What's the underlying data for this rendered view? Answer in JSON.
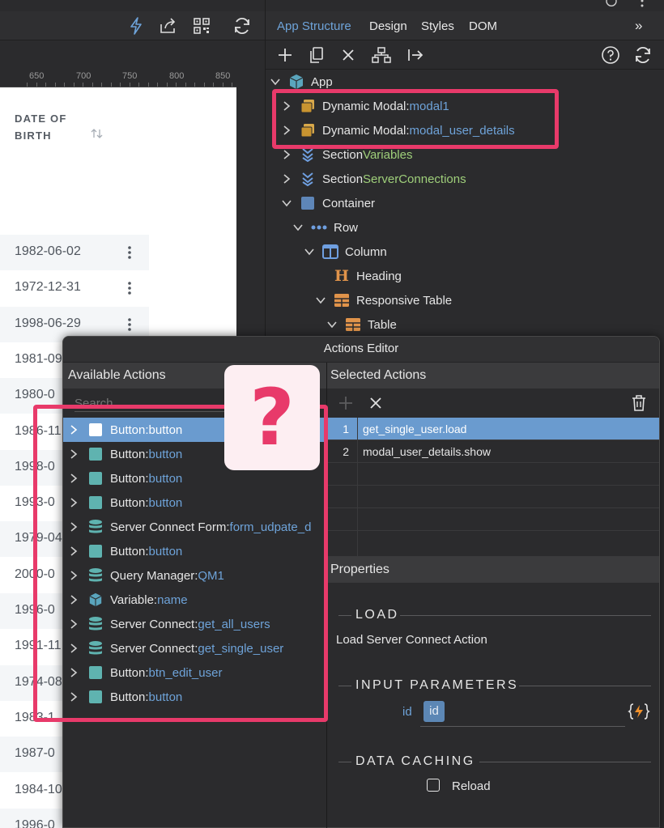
{
  "ruler": {
    "ticks": [
      "650",
      "700",
      "750",
      "800",
      "850"
    ]
  },
  "table": {
    "column_header": "DATE OF BIRTH",
    "rows": [
      "1982-06-02",
      "1972-12-31",
      "1998-06-29",
      "1981-09",
      "1980-0",
      "1986-11",
      "1998-0",
      "1993-0",
      "1979-04",
      "2000-0",
      "1996-0",
      "1991-11",
      "1974-08",
      "1983-1",
      "1987-0",
      "1984-10",
      "1996-0"
    ]
  },
  "panel": {
    "tabs": [
      "App Structure",
      "Design",
      "Styles",
      "DOM"
    ],
    "active_tab": "App Structure",
    "more": "»"
  },
  "tree": {
    "items": [
      {
        "label": "App",
        "value": ""
      },
      {
        "label": "Dynamic Modal: ",
        "value": "modal1"
      },
      {
        "label": "Dynamic Modal: ",
        "value": "modal_user_details"
      },
      {
        "label": "Section ",
        "value": "Variables"
      },
      {
        "label": "Section ",
        "value": "ServerConnections"
      },
      {
        "label": "Container",
        "value": ""
      },
      {
        "label": "Row",
        "value": ""
      },
      {
        "label": "Column",
        "value": ""
      },
      {
        "label": "Heading",
        "value": ""
      },
      {
        "label": "Responsive Table",
        "value": ""
      },
      {
        "label": "Table",
        "value": ""
      }
    ]
  },
  "actions_editor": {
    "title": "Actions Editor",
    "available_header": "Available Actions",
    "search_placeholder": "Search",
    "selected_header": "Selected Actions",
    "properties_header": "Properties",
    "available": [
      {
        "label": "Button: ",
        "value": "button",
        "icon": "button-icon"
      },
      {
        "label": "Button: ",
        "value": "button",
        "icon": "button-icon"
      },
      {
        "label": "Button: ",
        "value": "button",
        "icon": "button-icon"
      },
      {
        "label": "Button: ",
        "value": "button",
        "icon": "button-icon"
      },
      {
        "label": "Server Connect Form: ",
        "value": "form_udpate_d",
        "icon": "database-icon"
      },
      {
        "label": "Button: ",
        "value": "button",
        "icon": "button-icon"
      },
      {
        "label": "Query Manager: ",
        "value": "QM1",
        "icon": "database-icon"
      },
      {
        "label": "Variable: ",
        "value": "name",
        "icon": "cube-icon"
      },
      {
        "label": "Server Connect: ",
        "value": "get_all_users",
        "icon": "database-icon"
      },
      {
        "label": "Server Connect: ",
        "value": "get_single_user",
        "icon": "database-icon"
      },
      {
        "label": "Button: ",
        "value": "btn_edit_user",
        "icon": "button-icon"
      },
      {
        "label": "Button: ",
        "value": "button",
        "icon": "button-icon"
      }
    ],
    "selected": [
      {
        "num": "1",
        "text": "get_single_user.load"
      },
      {
        "num": "2",
        "text": "modal_user_details.show"
      }
    ],
    "properties": {
      "load_title": "LOAD",
      "load_desc": "Load Server Connect Action",
      "input_title": "INPUT PARAMETERS",
      "param_label": "id",
      "param_value": "id",
      "caching_title": "DATA CACHING",
      "reload_label": "Reload",
      "reload_checked": false
    }
  },
  "overlay": {
    "question_mark": "?"
  },
  "colors": {
    "accent_blue": "#6ea3d9",
    "highlight_pink": "#e83a6a",
    "selection_blue": "#6a9bcf",
    "green_value": "#9fcf7a"
  }
}
